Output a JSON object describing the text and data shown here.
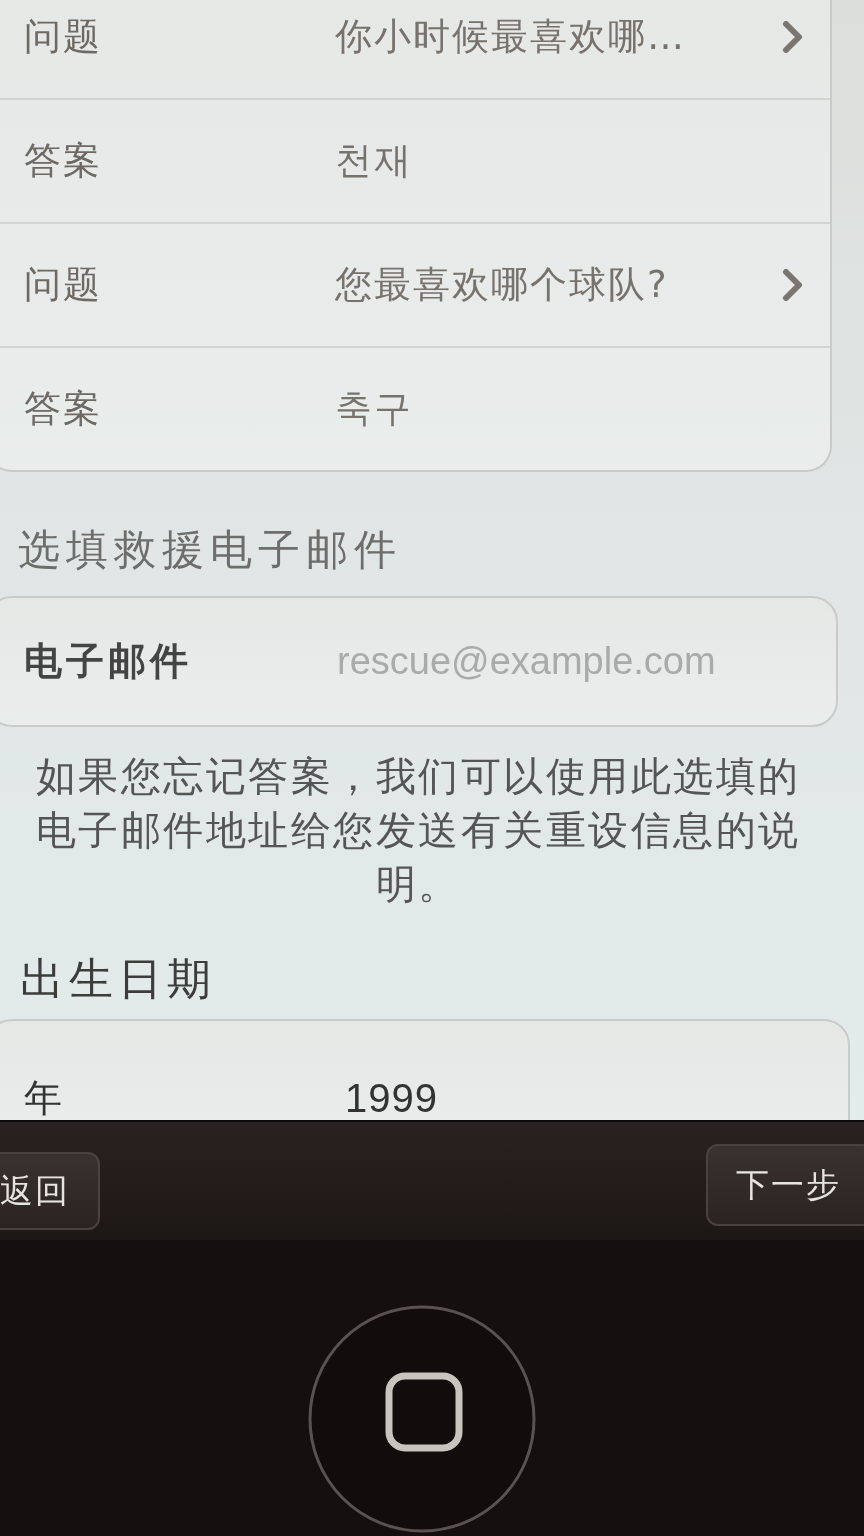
{
  "security_questions": {
    "rows": [
      {
        "kind": "picker",
        "label": "问题",
        "value": "你小时候最喜欢哪…"
      },
      {
        "kind": "text",
        "label": "答案",
        "value": "천재"
      },
      {
        "kind": "picker",
        "label": "问题",
        "value": "您最喜欢哪个球队?"
      },
      {
        "kind": "text",
        "label": "答案",
        "value": "축구"
      }
    ]
  },
  "rescue_email": {
    "header": "选填救援电子邮件",
    "field": {
      "label": "电子邮件",
      "placeholder": "rescue@example.com"
    },
    "note": "如果您忘记答案，我们可以使用此选填的电子邮件地址给您发送有关重设信息的说明。"
  },
  "birth_date": {
    "header": "出生日期",
    "rows": [
      {
        "label": "年",
        "value": "1999"
      }
    ]
  },
  "toolbar": {
    "back_button": "返回",
    "next_button": "下一步"
  }
}
